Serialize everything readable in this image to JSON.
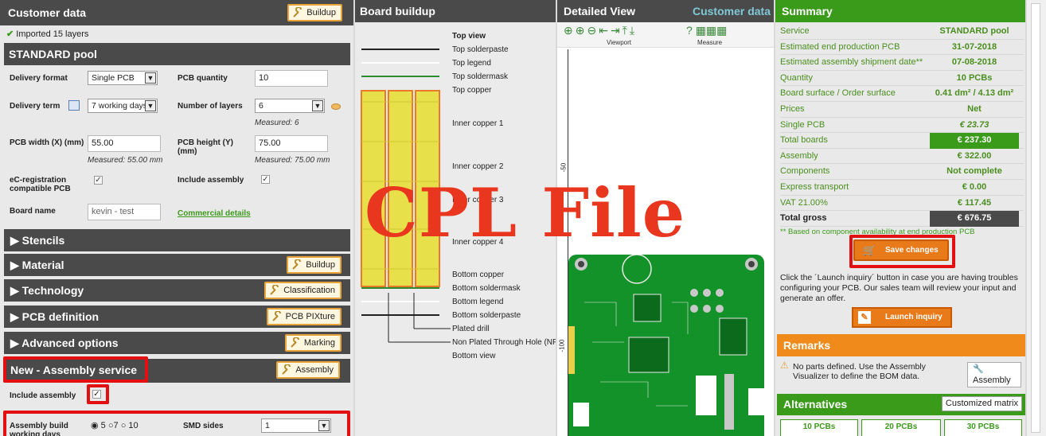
{
  "left": {
    "title": "Customer data",
    "buildup_btn": "Buildup",
    "imported": "Imported 15 layers",
    "pool": "STANDARD pool",
    "delivery_format_label": "Delivery format",
    "delivery_format": "Single PCB",
    "pcb_quantity_label": "PCB quantity",
    "pcb_quantity": "10",
    "delivery_term_label": "Delivery term",
    "delivery_term": "7 working days",
    "layers_label": "Number of layers",
    "layers": "6",
    "layers_measured": "Measured: 6",
    "width_label": "PCB width (X) (mm)",
    "width": "55.00",
    "width_measured": "Measured: 55.00 mm",
    "height_label": "PCB height (Y) (mm)",
    "height": "75.00",
    "height_measured": "Measured: 75.00 mm",
    "ecreg_label": "eC-registration compatible PCB",
    "include_assembly_label": "Include assembly",
    "board_name_label": "Board name",
    "board_name": "kevin - test",
    "commercial_details": "Commercial details",
    "sections": [
      {
        "label": "Stencils"
      },
      {
        "label": "Material",
        "btn": "Buildup"
      },
      {
        "label": "Technology",
        "btn": "Classification"
      },
      {
        "label": "PCB definition",
        "btn": "PCB PIXture"
      },
      {
        "label": "Advanced options",
        "btn": "Marking"
      }
    ],
    "assembly_title": "New - Assembly service",
    "assembly_btn": "Assembly",
    "include_assembly2": "Include assembly",
    "build_days_label": "Assembly build working days",
    "days": [
      "5",
      "7",
      "10"
    ],
    "smd_label": "SMD sides",
    "smd": "1"
  },
  "board": {
    "title": "Board buildup",
    "layers": [
      "Top view",
      "Top solderpaste",
      "Top legend",
      "Top soldermask",
      "Top copper",
      "Inner copper 1",
      "Inner copper 2",
      "Inner copper 3",
      "Inner copper 4",
      "Bottom copper",
      "Bottom soldermask",
      "Bottom legend",
      "Bottom solderpaste",
      "Plated drill",
      "Non Plated Through Hole (NPTH)",
      "Bottom view"
    ]
  },
  "detail": {
    "title": "Detailed View",
    "customer_link": "Customer data",
    "viewport": "Viewport",
    "measure": "Measure",
    "axis_m50": "-50",
    "axis_m100": "-100"
  },
  "overlay": {
    "text": "CPL File"
  },
  "summary": {
    "title": "Summary",
    "rows": [
      {
        "label": "Service",
        "value": "STANDARD pool"
      },
      {
        "label": "Estimated end production PCB",
        "value": "31-07-2018"
      },
      {
        "label": "Estimated assembly shipment date**",
        "value": "07-08-2018"
      },
      {
        "label": "Quantity",
        "value": "10 PCBs"
      },
      {
        "label": "Board surface / Order surface",
        "value": "0.41 dm² / 4.13 dm²"
      },
      {
        "label": "Prices",
        "value": "Net"
      },
      {
        "label": "Single PCB",
        "value": "€ 23.73"
      },
      {
        "label": "Total boards",
        "value": "€ 237.30"
      },
      {
        "label": "Assembly",
        "value": "€ 322.00"
      },
      {
        "label": "Components",
        "value": "Not complete"
      },
      {
        "label": "Express transport",
        "value": "€ 0.00"
      },
      {
        "label": "VAT 21.00%",
        "value": "€ 117.45"
      },
      {
        "label": "Total gross",
        "value": "€ 676.75"
      }
    ],
    "footnote": "** Based on component availability at end production PCB",
    "save": "Save changes",
    "inquiry_text": "Click the ´Launch inquiry´ button in case you are having troubles configuring your PCB. Our sales team will review your input and generate an offer.",
    "launch": "Launch inquiry",
    "remarks_title": "Remarks",
    "remarks_text": "No parts defined. Use the Assembly Visualizer to define the BOM data.",
    "assembly_btn": "Assembly",
    "alternatives_title": "Alternatives",
    "customized": "Customized matrix",
    "alts": [
      "10 PCBs",
      "20 PCBs",
      "30 PCBs"
    ]
  },
  "colors": {
    "green": "#3a9a1a",
    "orange": "#e8a23a",
    "red": "#e21010",
    "overlay": "#e8361f"
  }
}
